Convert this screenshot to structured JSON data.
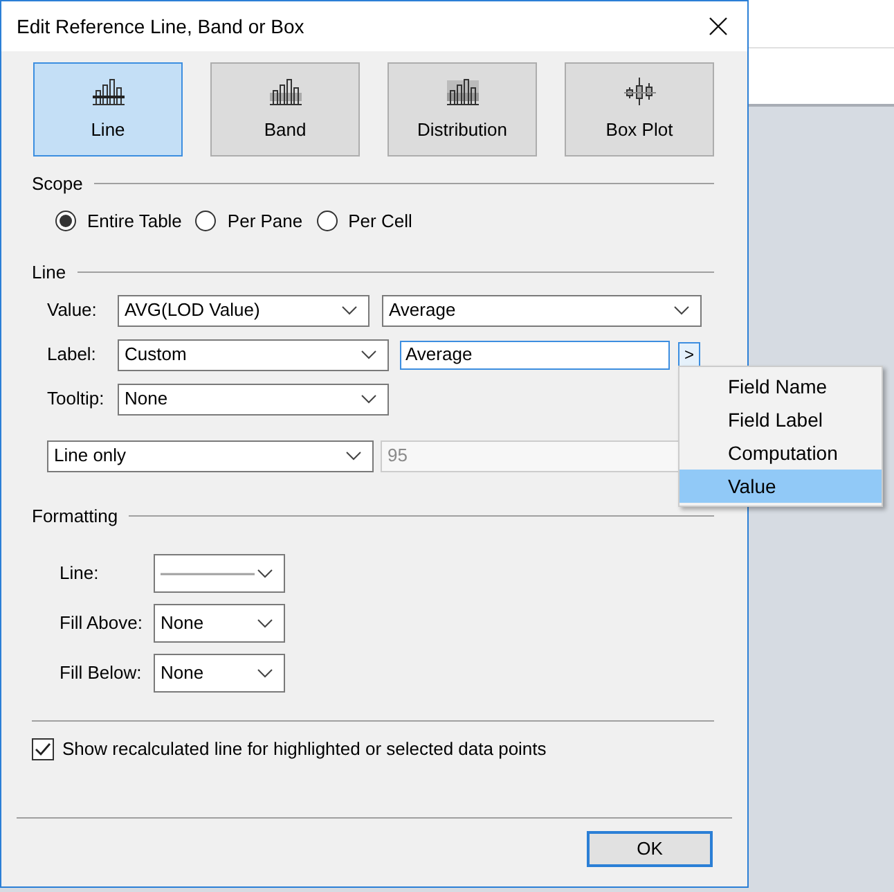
{
  "window": {
    "title": "Edit Reference Line, Band or Box"
  },
  "type_buttons": [
    {
      "label": "Line",
      "kind": "line",
      "selected": true
    },
    {
      "label": "Band",
      "kind": "band",
      "selected": false
    },
    {
      "label": "Distribution",
      "kind": "distribution",
      "selected": false
    },
    {
      "label": "Box Plot",
      "kind": "boxplot",
      "selected": false
    }
  ],
  "scope": {
    "title": "Scope",
    "options": [
      {
        "label": "Entire Table",
        "selected": true
      },
      {
        "label": "Per Pane",
        "selected": false
      },
      {
        "label": "Per Cell",
        "selected": false
      }
    ]
  },
  "line": {
    "title": "Line",
    "value_label": "Value:",
    "value_field": "AVG(LOD Value)",
    "aggregation": "Average",
    "label_label": "Label:",
    "label_type": "Custom",
    "label_text": "Average",
    "insert_button": ">",
    "tooltip_label": "Tooltip:",
    "tooltip": "None",
    "display": "Line only",
    "percent": {
      "value": "95",
      "disabled": true
    }
  },
  "popup_menu": [
    {
      "label": "Field Name",
      "selected": false
    },
    {
      "label": "Field Label",
      "selected": false
    },
    {
      "label": "Computation",
      "selected": false
    },
    {
      "label": "Value",
      "selected": true
    }
  ],
  "formatting": {
    "title": "Formatting",
    "line_label": "Line:",
    "fill_above_label": "Fill Above:",
    "fill_above": "None",
    "fill_below_label": "Fill Below:",
    "fill_below": "None"
  },
  "recalc": {
    "label": "Show recalculated line for highlighted or selected data points",
    "checked": true
  },
  "ok_button": "OK"
}
